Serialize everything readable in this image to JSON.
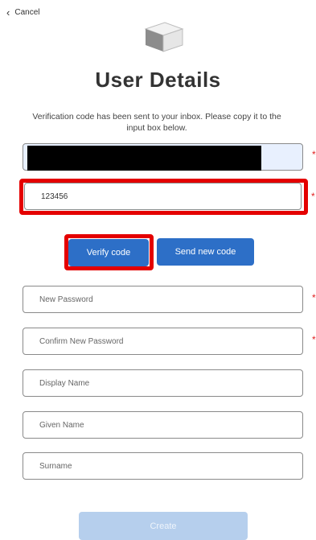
{
  "nav": {
    "cancel_label": "Cancel",
    "chevron_icon": "chevron-left-icon"
  },
  "header": {
    "logo_icon": "box-icon",
    "title": "User Details"
  },
  "message": "Verification code has been sent to your inbox. Please copy it to the input box below.",
  "fields": {
    "email": {
      "value": "",
      "required": true
    },
    "code": {
      "value": "123456",
      "required": true
    },
    "new_password": {
      "placeholder": "New Password",
      "required": true
    },
    "confirm_password": {
      "placeholder": "Confirm New Password",
      "required": true
    },
    "display_name": {
      "placeholder": "Display Name"
    },
    "given_name": {
      "placeholder": "Given Name"
    },
    "surname": {
      "placeholder": "Surname"
    }
  },
  "required_mark": "*",
  "buttons": {
    "verify": "Verify code",
    "send_new": "Send new code",
    "create": "Create"
  },
  "colors": {
    "primary": "#2d6fc7",
    "highlight": "#e40000",
    "required": "#e02020",
    "create_disabled": "#b6cfed"
  }
}
